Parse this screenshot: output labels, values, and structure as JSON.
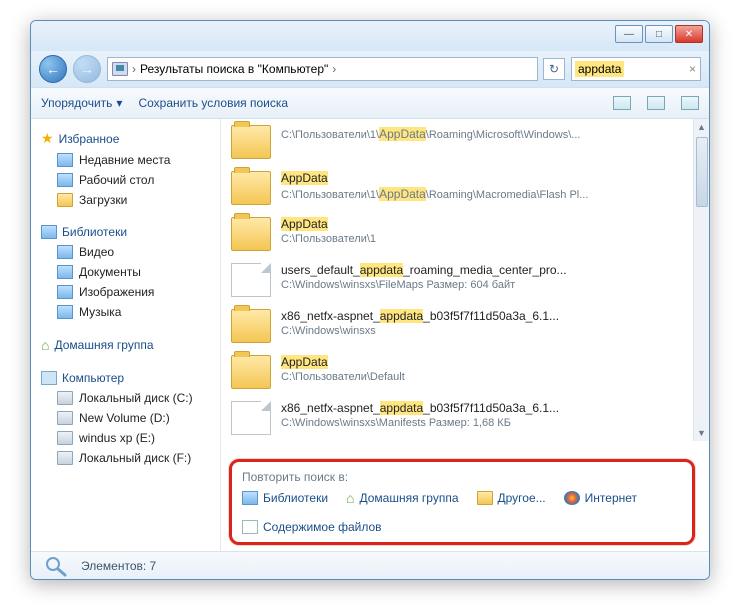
{
  "window": {
    "min": "—",
    "max": "□",
    "close": "✕"
  },
  "nav": {
    "back": "←",
    "forward": "→",
    "refresh": "↻",
    "clear": "×"
  },
  "address": {
    "crumb1": "Результаты поиска в \"Компьютер\"",
    "sep": "›"
  },
  "search": {
    "query": "appdata"
  },
  "toolbar": {
    "organize": "Упорядочить",
    "organize_arrow": "▾",
    "save_search": "Сохранить условия поиска"
  },
  "sidebar": {
    "favorites": {
      "title": "Избранное",
      "items": [
        "Недавние места",
        "Рабочий стол",
        "Загрузки"
      ]
    },
    "libraries": {
      "title": "Библиотеки",
      "items": [
        "Видео",
        "Документы",
        "Изображения",
        "Музыка"
      ]
    },
    "homegroup": {
      "title": "Домашняя группа"
    },
    "computer": {
      "title": "Компьютер",
      "items": [
        "Локальный диск (C:)",
        "New Volume (D:)",
        "windus xp (E:)",
        "Локальный диск (F:)"
      ]
    }
  },
  "results": [
    {
      "type": "folder",
      "pre": "",
      "hl": "",
      "post": "",
      "path_pre": "C:\\Пользователи\\1\\",
      "path_hl": "AppData",
      "path_post": "\\Roaming\\Microsoft\\Windows\\..."
    },
    {
      "type": "folder",
      "pre": "",
      "hl": "AppData",
      "post": "",
      "path_pre": "C:\\Пользователи\\1\\",
      "path_hl": "AppData",
      "path_post": "\\Roaming\\Macromedia\\Flash Pl..."
    },
    {
      "type": "folder",
      "pre": "",
      "hl": "AppData",
      "post": "",
      "path_pre": "C:\\Пользователи\\1",
      "path_hl": "",
      "path_post": ""
    },
    {
      "type": "file",
      "pre": "users_default_",
      "hl": "appdata",
      "post": "_roaming_media_center_pro...",
      "path_pre": "C:\\Windows\\winsxs\\FileMaps",
      "path_hl": "",
      "path_post": "       Размер: 604 байт"
    },
    {
      "type": "folder",
      "pre": "x86_netfx-aspnet_",
      "hl": "appdata",
      "post": "_b03f5f7f11d50a3a_6.1...",
      "path_pre": "C:\\Windows\\winsxs",
      "path_hl": "",
      "path_post": ""
    },
    {
      "type": "folder",
      "pre": "",
      "hl": "AppData",
      "post": "",
      "path_pre": "C:\\Пользователи\\Default",
      "path_hl": "",
      "path_post": ""
    },
    {
      "type": "file",
      "pre": "x86_netfx-aspnet_",
      "hl": "appdata",
      "post": "_b03f5f7f11d50a3a_6.1...",
      "path_pre": "C:\\Windows\\winsxs\\Manifests",
      "path_hl": "",
      "path_post": "       Размер: 1,68 КБ"
    }
  ],
  "repeat": {
    "title": "Повторить поиск в:",
    "links": [
      "Библиотеки",
      "Домашняя группа",
      "Другое...",
      "Интернет",
      "Содержимое файлов"
    ]
  },
  "status": {
    "count": "Элементов: 7"
  }
}
